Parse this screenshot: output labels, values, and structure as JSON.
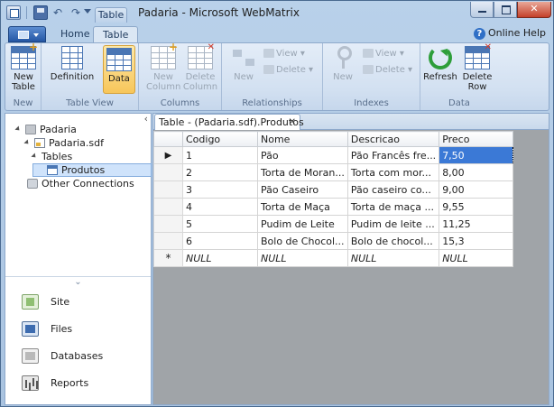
{
  "window": {
    "title": "Padaria - Microsoft WebMatrix",
    "context_tab": "Table"
  },
  "ribbon_tabs": {
    "home": "Home",
    "table": "Table",
    "help": "Online Help"
  },
  "ribbon": {
    "new_group": {
      "label": "New",
      "new_table": "New Table"
    },
    "table_view_group": {
      "label": "Table View",
      "definition": "Definition",
      "data": "Data"
    },
    "columns_group": {
      "label": "Columns",
      "new_column": "New Column",
      "delete_column": "Delete Column"
    },
    "relationships_group": {
      "label": "Relationships",
      "new": "New",
      "view": "View",
      "delete": "Delete"
    },
    "indexes_group": {
      "label": "Indexes",
      "new": "New",
      "view": "View",
      "delete": "Delete"
    },
    "data_group": {
      "label": "Data",
      "refresh": "Refresh",
      "delete_row": "Delete Row"
    }
  },
  "tree": {
    "root": "Padaria",
    "database": "Padaria.sdf",
    "tables_folder": "Tables",
    "table": "Produtos",
    "other": "Other Connections"
  },
  "workspaces": [
    "Site",
    "Files",
    "Databases",
    "Reports"
  ],
  "document": {
    "tab_title": "Table - (Padaria.sdf).Produtos",
    "columns": [
      "Codigo",
      "Nome",
      "Descricao",
      "Preco"
    ],
    "rows": [
      [
        "1",
        "Pão",
        "Pão Francês fre...",
        "7,50"
      ],
      [
        "2",
        "Torta de Moran...",
        "Torta com mor...",
        "8,00"
      ],
      [
        "3",
        "Pão Caseiro",
        "Pão caseiro co...",
        "9,00"
      ],
      [
        "4",
        "Torta de Maça",
        "Torta de maça ...",
        "9,55"
      ],
      [
        "5",
        "Pudim de Leite",
        "Pudim de leite ...",
        "11,25"
      ],
      [
        "6",
        "Bolo de Chocol...",
        "Bolo de chocol...",
        "15,3"
      ]
    ],
    "null_row": [
      "NULL",
      "NULL",
      "NULL",
      "NULL"
    ],
    "current_row_marker": "▶",
    "new_row_marker": "*"
  },
  "colors": {
    "accent": "#3b79d6",
    "ribbon_bg": "#dbe7f4",
    "active_button": "#f7c65a",
    "grid_bg": "#a0a4a8"
  }
}
